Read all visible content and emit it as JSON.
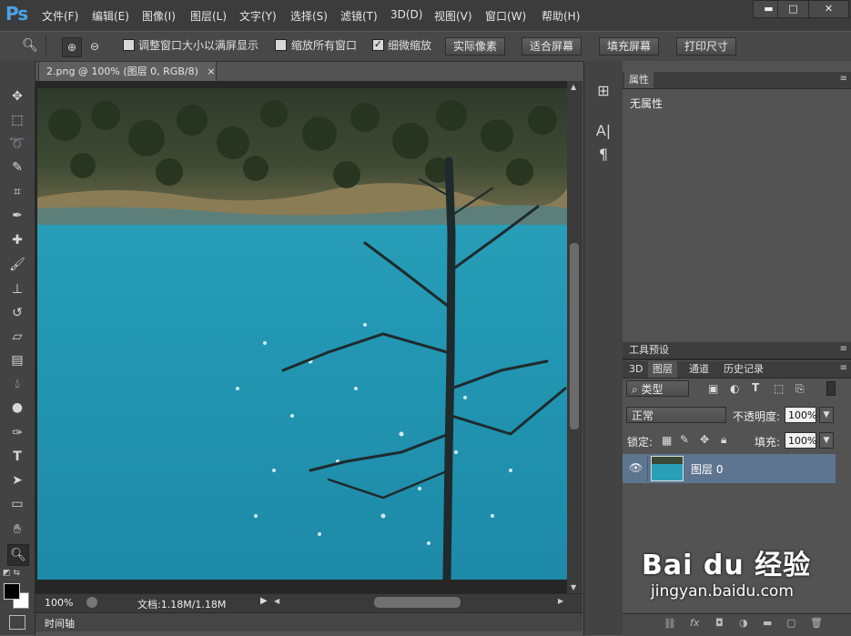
{
  "app": {
    "logo": "Ps"
  },
  "menu": [
    "文件(F)",
    "编辑(E)",
    "图像(I)",
    "图层(L)",
    "文字(Y)",
    "选择(S)",
    "滤镜(T)",
    "3D(D)",
    "视图(V)",
    "窗口(W)",
    "帮助(H)"
  ],
  "window_buttons": {
    "minimize": "▬",
    "maximize": "□",
    "close": "✕"
  },
  "options": {
    "resize_windows": "调整窗口大小以满屏显示",
    "zoom_all": "缩放所有窗口",
    "scrubby_zoom": "细微缩放",
    "actual_pixels": "实际像素",
    "fit_screen": "适合屏幕",
    "fill_screen": "填充屏幕",
    "print_size": "打印尺寸",
    "resize_checked": false,
    "zoom_all_checked": false,
    "scrubby_checked": true
  },
  "document": {
    "tab_title": "2.png @ 100% (图层 0, RGB/8)",
    "close": "×",
    "zoom": "100%",
    "doc_info": "文档:1.18M/1.18M"
  },
  "timeline_label": "时间轴",
  "panels": {
    "properties": {
      "tab": "属性",
      "content": "无属性"
    },
    "tool_presets": "工具预设",
    "tabs": [
      "3D",
      "图层",
      "通道",
      "历史记录"
    ],
    "filter_kind": "类型",
    "blend_mode": "正常",
    "opacity_label": "不透明度:",
    "opacity_value": "100%",
    "lock_label": "锁定:",
    "fill_label": "填充:",
    "fill_value": "100%",
    "layer_name": "图层 0"
  },
  "watermark": {
    "brand": "Bai du 经验",
    "url": "jingyan.baidu.com"
  }
}
